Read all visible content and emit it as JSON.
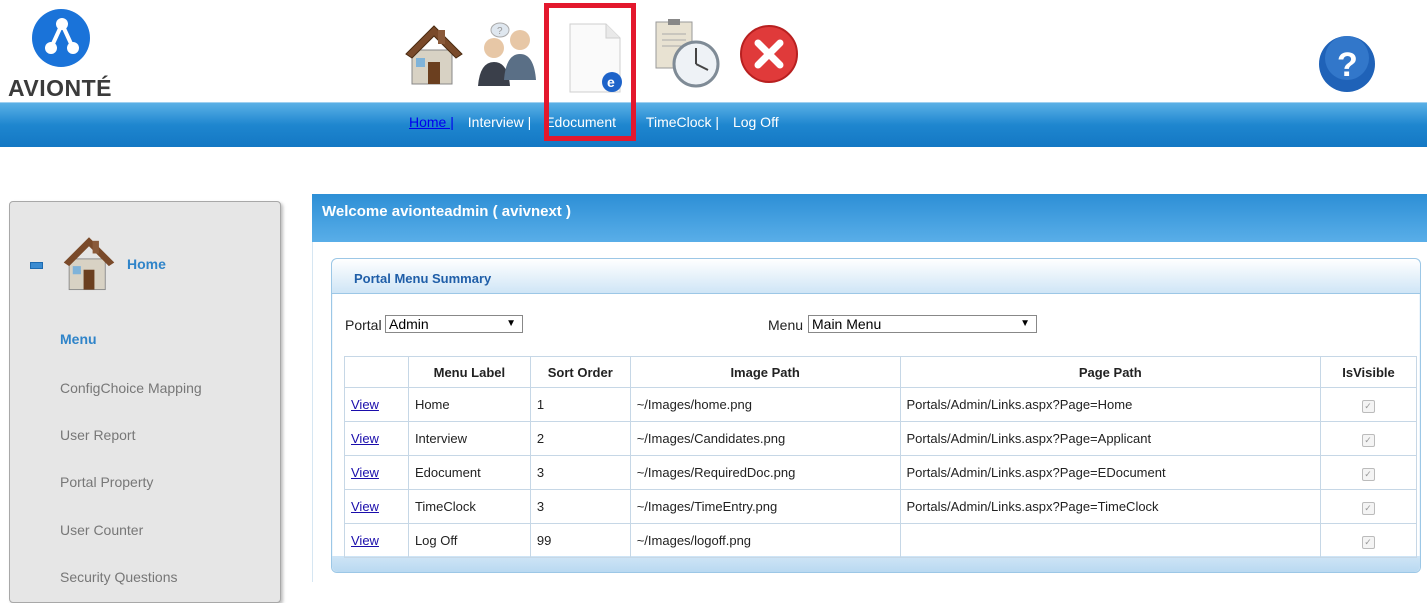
{
  "brand": {
    "name": "AVIONTÉ",
    "accent": "#1e86cf"
  },
  "toolbar": {
    "icons": [
      "home-icon",
      "interview-icon",
      "edocument-icon",
      "timeclock-icon",
      "logoff-icon",
      "help-icon"
    ]
  },
  "nav": {
    "items": [
      {
        "label": "Home |"
      },
      {
        "label": "Interview |"
      },
      {
        "label": "Edocument"
      },
      {
        "label": "TimeClock |"
      },
      {
        "label": "Log Off"
      }
    ]
  },
  "sidebar": {
    "home_label": "Home",
    "items": [
      {
        "label": "Menu"
      },
      {
        "label": "ConfigChoice Mapping"
      },
      {
        "label": "User Report"
      },
      {
        "label": "Portal Property"
      },
      {
        "label": "User Counter"
      },
      {
        "label": "Security Questions"
      }
    ]
  },
  "welcome": "Welcome avionteadmin ( avivnext )",
  "panel": {
    "title": "Portal Menu Summary",
    "portal_label": "Portal",
    "portal_value": "Admin",
    "menu_label": "Menu",
    "menu_value": "Main Menu"
  },
  "table": {
    "headers": [
      "",
      "Menu Label",
      "Sort Order",
      "Image Path",
      "Page Path",
      "IsVisible"
    ],
    "rows": [
      {
        "link": "View",
        "label": "Home",
        "sort": "1",
        "image": "~/Images/home.png",
        "page": "Portals/Admin/Links.aspx?Page=Home",
        "visible": true
      },
      {
        "link": "View",
        "label": "Interview",
        "sort": "2",
        "image": "~/Images/Candidates.png",
        "page": "Portals/Admin/Links.aspx?Page=Applicant",
        "visible": true
      },
      {
        "link": "View",
        "label": "Edocument",
        "sort": "3",
        "image": "~/Images/RequiredDoc.png",
        "page": "Portals/Admin/Links.aspx?Page=EDocument",
        "visible": true
      },
      {
        "link": "View",
        "label": "TimeClock",
        "sort": "3",
        "image": "~/Images/TimeEntry.png",
        "page": "Portals/Admin/Links.aspx?Page=TimeClock",
        "visible": true
      },
      {
        "link": "View",
        "label": "Log Off",
        "sort": "99",
        "image": "~/Images/logoff.png",
        "page": "",
        "visible": true
      }
    ]
  }
}
